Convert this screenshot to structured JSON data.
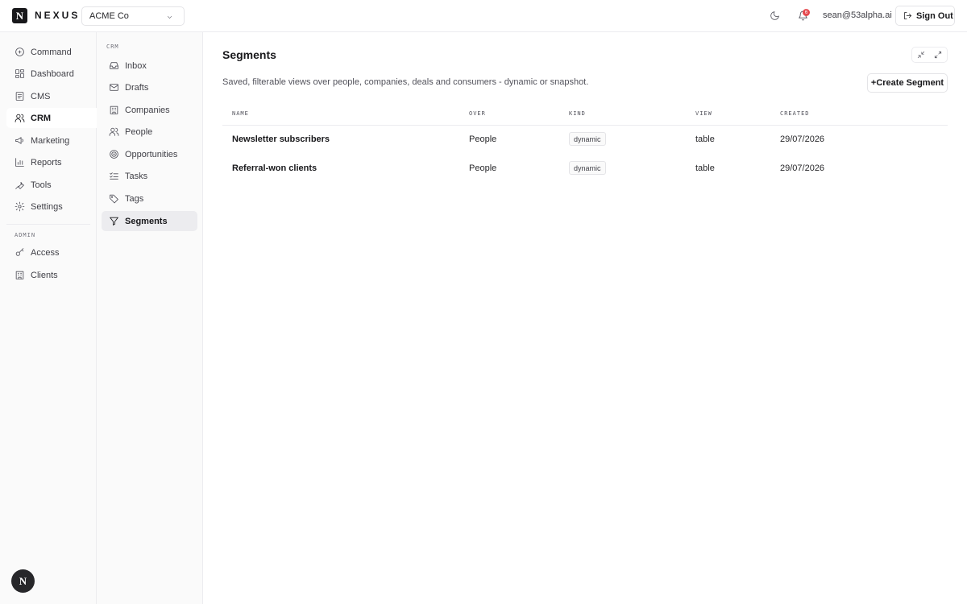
{
  "brand": {
    "logo_letter": "N",
    "name": "NEXUS"
  },
  "org_select": {
    "value": "ACME Co"
  },
  "header": {
    "notification_count": "6",
    "user_email": "sean@53alpha.ai",
    "sign_out_label": "Sign Out"
  },
  "sidebar": {
    "items": [
      {
        "label": "Command",
        "icon": "command-icon"
      },
      {
        "label": "Dashboard",
        "icon": "dashboard-icon"
      },
      {
        "label": "CMS",
        "icon": "cms-icon"
      },
      {
        "label": "CRM",
        "icon": "users-icon",
        "active": true
      },
      {
        "label": "Marketing",
        "icon": "megaphone-icon"
      },
      {
        "label": "Reports",
        "icon": "chart-icon"
      },
      {
        "label": "Tools",
        "icon": "wrench-icon"
      },
      {
        "label": "Settings",
        "icon": "gear-icon"
      }
    ],
    "admin_label": "ADMIN",
    "admin_items": [
      {
        "label": "Access",
        "icon": "key-icon"
      },
      {
        "label": "Clients",
        "icon": "building-icon"
      }
    ],
    "fab_letter": "N"
  },
  "subnav": {
    "section_label": "CRM",
    "items": [
      {
        "label": "Inbox",
        "icon": "inbox-icon"
      },
      {
        "label": "Drafts",
        "icon": "mail-icon"
      },
      {
        "label": "Companies",
        "icon": "building-icon"
      },
      {
        "label": "People",
        "icon": "people-icon"
      },
      {
        "label": "Opportunities",
        "icon": "target-icon"
      },
      {
        "label": "Tasks",
        "icon": "list-check-icon"
      },
      {
        "label": "Tags",
        "icon": "tag-icon"
      },
      {
        "label": "Segments",
        "icon": "filter-icon",
        "active": true
      }
    ]
  },
  "main": {
    "title": "Segments",
    "subtitle": "Saved, filterable views over people, companies, deals and consumers - dynamic or snapshot.",
    "create_label": "+Create Segment",
    "table": {
      "headers": [
        "NAME",
        "OVER",
        "KIND",
        "VIEW",
        "CREATED"
      ],
      "rows": [
        {
          "name": "Newsletter subscribers",
          "over": "People",
          "kind": "dynamic",
          "view": "table",
          "created": "29/07/2026"
        },
        {
          "name": "Referral-won clients",
          "over": "People",
          "kind": "dynamic",
          "view": "table",
          "created": "29/07/2026"
        }
      ]
    }
  },
  "colors": {
    "accent_dark": "#18181b",
    "badge_red": "#e5484d",
    "border": "#ececef"
  }
}
